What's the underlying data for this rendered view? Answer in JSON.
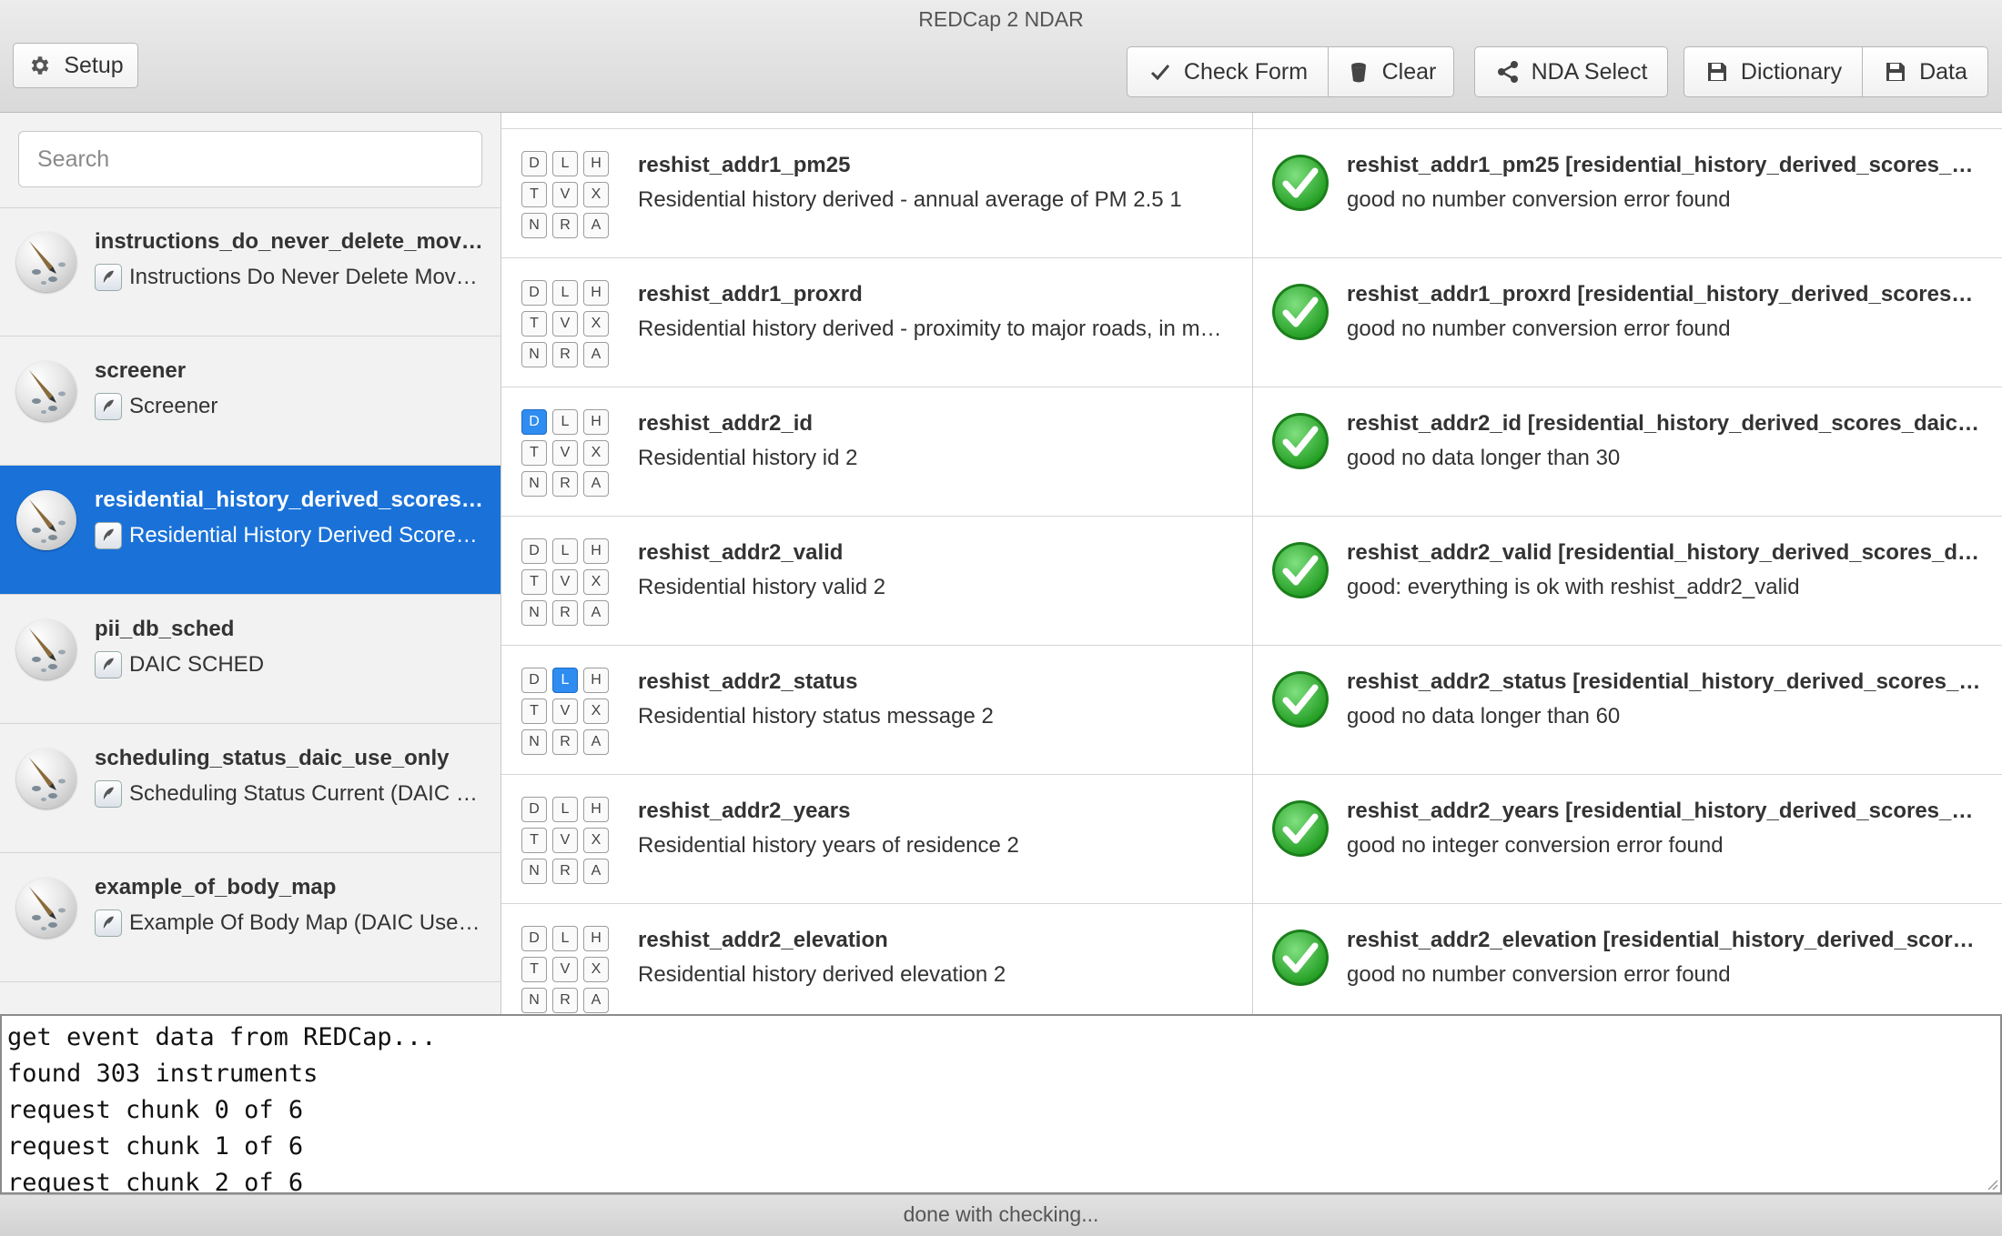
{
  "window": {
    "title": "REDCap 2 NDAR"
  },
  "toolbar": {
    "setup_label": "Setup",
    "check_form_label": "Check Form",
    "clear_label": "Clear",
    "nda_select_label": "NDA Select",
    "dictionary_label": "Dictionary",
    "data_label": "Data"
  },
  "search": {
    "placeholder": "Search"
  },
  "instruments": [
    {
      "name": "instructions_do_never_delete_mov…",
      "label": "Instructions Do Never Delete Mov…"
    },
    {
      "name": "screener",
      "label": "Screener"
    },
    {
      "name": "residential_history_derived_scores…",
      "label": "Residential History Derived Score…"
    },
    {
      "name": "pii_db_sched",
      "label": "DAIC SCHED"
    },
    {
      "name": "scheduling_status_daic_use_only",
      "label": "Scheduling Status Current (DAIC …"
    },
    {
      "name": "example_of_body_map",
      "label": "Example Of Body Map (DAIC Use…"
    }
  ],
  "badges": [
    "D",
    "L",
    "H",
    "T",
    "V",
    "X",
    "N",
    "R",
    "A"
  ],
  "fields": [
    {
      "name": "reshist_addr1_pm25",
      "description": "Residential history derived - annual average of PM 2.5 1",
      "result_title": "reshist_addr1_pm25 [residential_history_derived_scores_d…",
      "result_message": "good no number conversion error found",
      "active_badges": []
    },
    {
      "name": "reshist_addr1_proxrd",
      "description": "Residential history derived - proximity to major roads, in m…",
      "result_title": "reshist_addr1_proxrd [residential_history_derived_scores_…",
      "result_message": "good no number conversion error found",
      "active_badges": []
    },
    {
      "name": "reshist_addr2_id",
      "description": "Residential history id 2",
      "result_title": "reshist_addr2_id [residential_history_derived_scores_daic_…",
      "result_message": "good no data longer than 30",
      "active_badges": [
        "D"
      ]
    },
    {
      "name": "reshist_addr2_valid",
      "description": "Residential history valid 2",
      "result_title": "reshist_addr2_valid [residential_history_derived_scores_da…",
      "result_message": "good: everything is ok with reshist_addr2_valid",
      "active_badges": []
    },
    {
      "name": "reshist_addr2_status",
      "description": "Residential history status message 2",
      "result_title": "reshist_addr2_status [residential_history_derived_scores_d…",
      "result_message": "good no data longer than 60",
      "active_badges": [
        "L"
      ]
    },
    {
      "name": "reshist_addr2_years",
      "description": "Residential history years of residence 2",
      "result_title": "reshist_addr2_years [residential_history_derived_scores_d…",
      "result_message": "good no integer conversion error found",
      "active_badges": []
    },
    {
      "name": "reshist_addr2_elevation",
      "description": "Residential history derived elevation 2",
      "result_title": "reshist_addr2_elevation [residential_history_derived_score…",
      "result_message": "good no number conversion error found",
      "active_badges": []
    }
  ],
  "log": [
    "get event data from REDCap...",
    "found 303 instruments",
    "request chunk 0 of 6",
    "request chunk 1 of 6",
    "request chunk 2 of 6"
  ],
  "status": {
    "text": "done with checking..."
  },
  "colors": {
    "selection": "#1a72d9",
    "badge_active": "#2f8cf0",
    "check_green": "#2eb82e"
  }
}
